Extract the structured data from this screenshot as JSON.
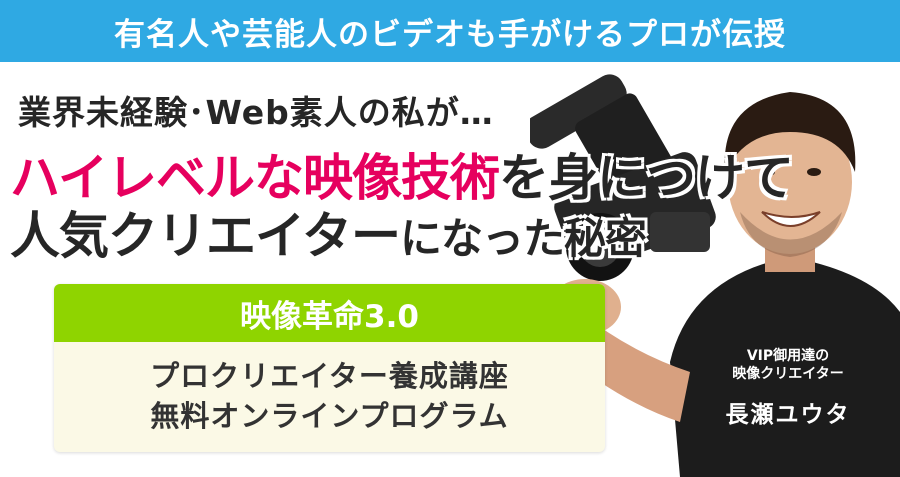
{
  "banner": {
    "text": "有名人や芸能人のビデオも手がけるプロが伝授"
  },
  "headline": {
    "line1": "業界未経験･Web素人の私が…",
    "line2_accent": "ハイレベルな映像技術",
    "line2_rest": "を身につけて",
    "line3_main": "人気クリエイター",
    "line3_rest": "になった秘密"
  },
  "program": {
    "title": "映像革命3.0",
    "line1": "プロクリエイター養成講座",
    "line2": "無料オンラインプログラム"
  },
  "presenter": {
    "title_line1": "VIP御用達の",
    "title_line2": "映像クリエイター",
    "name": "長瀬ユウタ"
  },
  "colors": {
    "banner": "#2fa9e3",
    "accent": "#e6005e",
    "program_title": "#8fd400",
    "program_bg": "#fbf9e6",
    "text": "#262626"
  }
}
